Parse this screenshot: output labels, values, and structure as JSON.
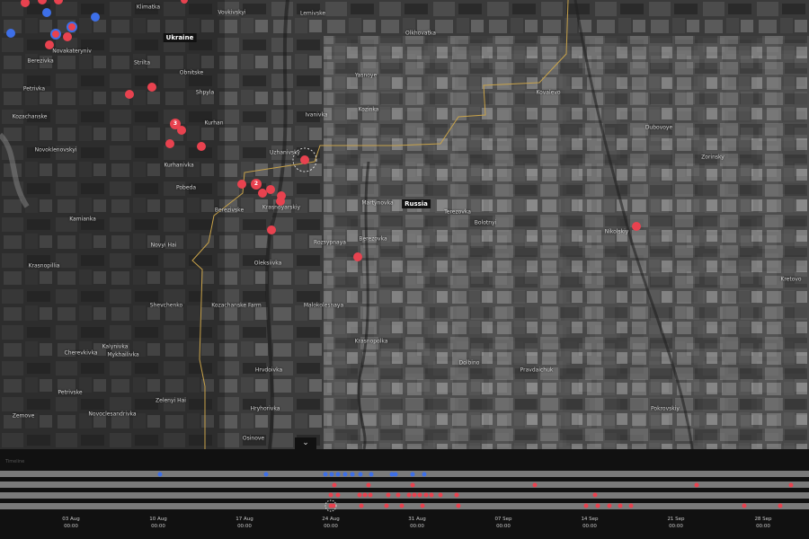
{
  "map": {
    "countries": [
      {
        "name": "Ukraine"
      },
      {
        "name": "Russia"
      }
    ],
    "places": [
      "Klimatka",
      "Vovkivskyi",
      "Lemivske",
      "Novakateryniv",
      "Berezivka",
      "Strilta",
      "Obnitske",
      "Shpyla",
      "Kurhan",
      "Petrivka",
      "Ivanivka",
      "Kozachanske",
      "Novoklenovskyi",
      "Kurhanivka",
      "Pobeda",
      "Berezivske",
      "Kamianka",
      "Novyi Hai",
      "Krasnopillia",
      "Shevchenko",
      "Kalynivka",
      "Zelenyi Hai",
      "Petrivske",
      "Hrvdoivka",
      "Kozachanske Farm",
      "Hryhorivka",
      "Oleksiivka",
      "Mykhailivka",
      "Cherevkivka",
      "Zemove",
      "Novoclesandrivka",
      "Osinove",
      "Uzhanivsky",
      "Krasnoyarskiy",
      "Martynovka",
      "Rozsypnaya",
      "Bolotnyi",
      "Berezovka",
      "Krasnopolka",
      "Malokolesnaya",
      "Dolbino",
      "Pravdaichuk",
      "Pokrovskiy",
      "Kovalevo",
      "Kozinka",
      "Yasnoye",
      "Olkhovatka",
      "Dubovoye",
      "Zorinsky",
      "Nikolskiy",
      "Terezovka",
      "Kretovo"
    ],
    "event_counts": [
      "3",
      "2"
    ]
  },
  "timeline": {
    "toggle_icon": "⌄",
    "label": "Timeline",
    "ticks": [
      {
        "date": "03 Aug",
        "time": "00:00"
      },
      {
        "date": "10 Aug",
        "time": "00:00"
      },
      {
        "date": "17 Aug",
        "time": "00:00"
      },
      {
        "date": "24 Aug",
        "time": "00:00"
      },
      {
        "date": "31 Aug",
        "time": "00:00"
      },
      {
        "date": "07 Sep",
        "time": "00:00"
      },
      {
        "date": "14 Sep",
        "time": "00:00"
      },
      {
        "date": "21 Sep",
        "time": "00:00"
      },
      {
        "date": "28 Sep",
        "time": "00:00"
      }
    ]
  },
  "colors": {
    "event_red": "#e8424f",
    "event_blue": "#3d6fe8",
    "border": "#c9a34a"
  }
}
